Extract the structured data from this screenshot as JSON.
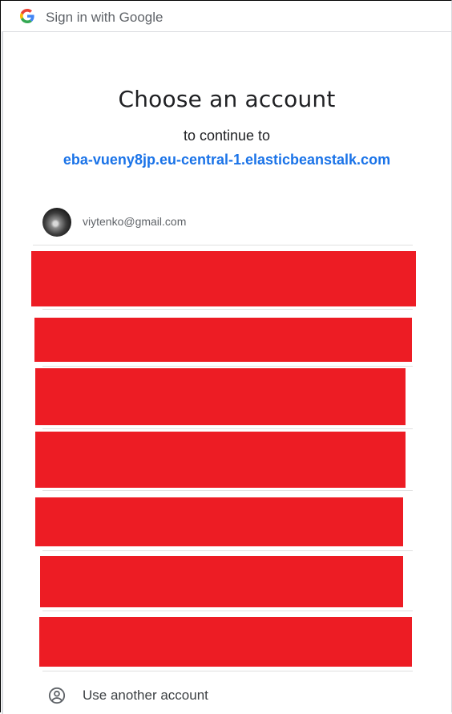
{
  "header": {
    "title": "Sign in with Google",
    "logo_icon": "google-g-icon"
  },
  "main": {
    "title": "Choose an account",
    "subtitle": "to continue to",
    "app_domain": "eba-vueny8jp.eu-central-1.elasticbeanstalk.com"
  },
  "accounts": [
    {
      "email": "viytenko@gmail.com",
      "avatar_icon": "avatar"
    }
  ],
  "use_another_account": {
    "label": "Use another account",
    "icon": "person-circle-icon"
  },
  "colors": {
    "link": "#1a73e8",
    "redaction": "#ed1c24",
    "divider": "#e0e0e0"
  }
}
